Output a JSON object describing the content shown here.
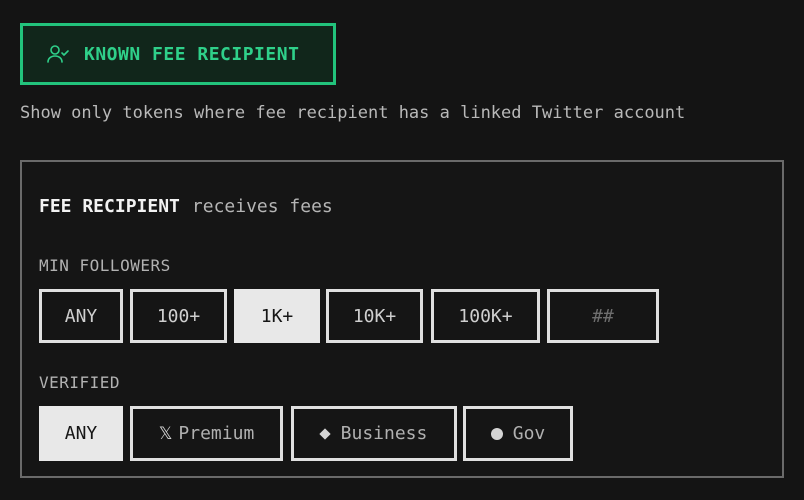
{
  "filter_toggle": {
    "label": "KNOWN FEE RECIPIENT",
    "icon": "user-check-icon",
    "accent_color": "#22c37c",
    "active": true
  },
  "description": "Show only tokens where fee recipient has a linked Twitter account",
  "panel": {
    "title_strong": "FEE RECIPIENT",
    "title_soft": "receives fees",
    "min_followers": {
      "label": "MIN FOLLOWERS",
      "options": [
        "ANY",
        "100+",
        "1K+",
        "10K+",
        "100K+"
      ],
      "selected": "1K+",
      "custom_placeholder": "##"
    },
    "verified": {
      "label": "VERIFIED",
      "options": [
        {
          "label": "ANY",
          "icon": ""
        },
        {
          "label": "Premium",
          "icon": "x-logo-icon"
        },
        {
          "label": "Business",
          "icon": "diamond-icon"
        },
        {
          "label": "Gov",
          "icon": "circle-icon"
        }
      ],
      "selected": "ANY"
    }
  }
}
